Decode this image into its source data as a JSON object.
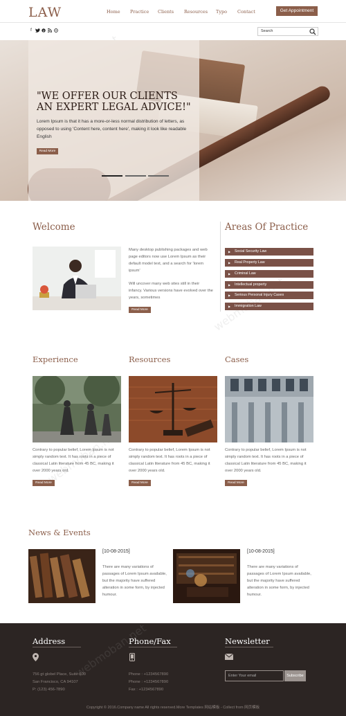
{
  "header": {
    "logo": "LAW",
    "nav": [
      "Home",
      "Practice",
      "Clients",
      "Resources",
      "Typo",
      "Contact"
    ],
    "cta": "Get Appointment",
    "social": [
      "f",
      "t",
      "p",
      "rss",
      "drb"
    ],
    "search_placeholder": "Search"
  },
  "hero": {
    "title": "\"WE OFFER OUR CLIENTS AN EXPERT LEGAL ADVICE!\"",
    "text": "Lorem Ipsum is that it has a more-or-less normal distribution of letters, as opposed to using 'Content here, content here', making it look like readable English",
    "button": "Read More"
  },
  "welcome": {
    "title": "Welcome",
    "para1": "Many desktop publishing packages and web page editors now use Lorem Ipsum as their default model text, and a search for 'lorem ipsum'",
    "para2": "Will uncover many web sites still in their infancy. Various versions have evolved over the years, sometimes",
    "button": "Read More"
  },
  "practice": {
    "title": "Areas Of Practice",
    "items": [
      "Social Security Law",
      "Real Property Law",
      "Criminal Law",
      "Intellectual property",
      "Serious Personal Injury Cases",
      "Immigration Law"
    ]
  },
  "cards": [
    {
      "title": "Experience",
      "text": "Contrary to popular belief, Lorem Ipsum is not simply random text. It has roots in a piece of classical Latin literature from 45 BC, making it over 2000 years old.",
      "button": "Read More"
    },
    {
      "title": "Resources",
      "text": "Contrary to popular belief, Lorem Ipsum is not simply random text. It has roots in a piece of classical Latin literature from 45 BC, making it over 2000 years old.",
      "button": "Read More"
    },
    {
      "title": "Cases",
      "text": "Contrary to popular belief, Lorem Ipsum is not simply random text. It has roots in a piece of classical Latin literature from 45 BC, making it over 2000 years old.",
      "button": "Read More"
    }
  ],
  "news": {
    "title": "News & Events",
    "items": [
      {
        "date": "[10-08-2015]",
        "text": "There are many variations of passages of Lorem Ipsum available, but the majority have suffered alteration in some form, by injected humour."
      },
      {
        "date": "[10-08-2015]",
        "text": "There are many variations of passages of Lorem Ipsum available, but the majority have suffered alteration in some form, by injected humour."
      }
    ]
  },
  "footer": {
    "address_title": "Address",
    "address_lines": [
      "756 gt globel Place, Suite 600",
      "San Francisco, CA 94107",
      "P: (123) 456-7890"
    ],
    "phone_title": "Phone/Fax",
    "phone_lines": [
      "Phone : +1234567890",
      "Phone : +1234567890",
      "Fax : +1234567890"
    ],
    "newsletter_title": "Newsletter",
    "newsletter_placeholder": "Enter Your email",
    "newsletter_button": "Subscribe",
    "copyright": "Copyright © 2016.Company name All rights reserved.More Templates 网站模板 - Collect from 网页模板"
  },
  "colors": {
    "accent": "#8b5e4a",
    "practice_bg": "#7a5147",
    "footer_bg": "#2c2523"
  }
}
